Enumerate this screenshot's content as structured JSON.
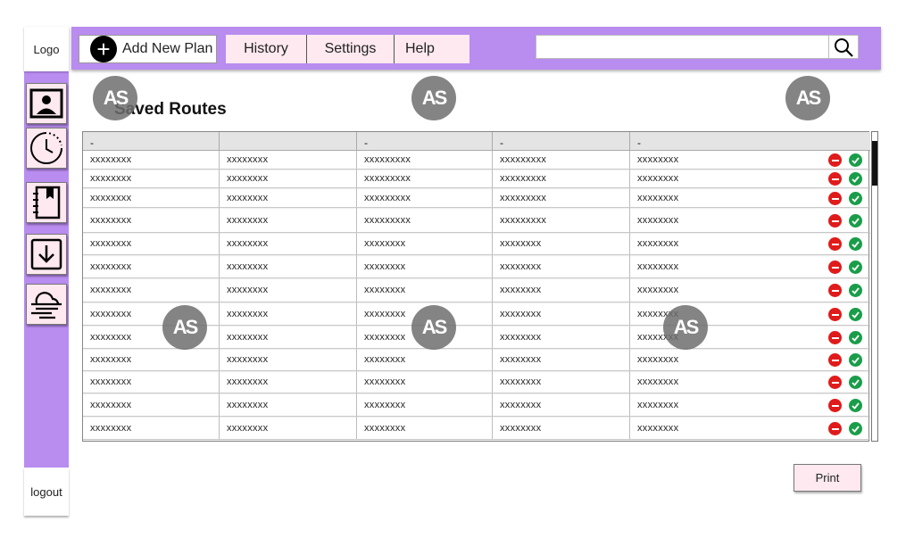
{
  "sidebar": {
    "logo_label": "Logo",
    "logout_label": "logout",
    "items": [
      {
        "icon": "contact-card-icon"
      },
      {
        "icon": "clock-history-icon"
      },
      {
        "icon": "bookmark-notebook-icon"
      },
      {
        "icon": "download-icon"
      },
      {
        "icon": "weather-cloud-wind-icon"
      }
    ]
  },
  "topbar": {
    "add_label": "Add New Plan",
    "nav": {
      "history": "History",
      "settings": "Settings",
      "help": "Help"
    },
    "search": {
      "value": "",
      "placeholder": ""
    }
  },
  "page": {
    "title": "Saved Routes"
  },
  "table": {
    "headers": [
      "-",
      "",
      "-",
      "-",
      "-"
    ],
    "rows": [
      [
        "xxxxxxxx",
        "xxxxxxxx",
        "xxxxxxxxx",
        "xxxxxxxxx",
        "xxxxxxxx"
      ],
      [
        "xxxxxxxx",
        "xxxxxxxx",
        "xxxxxxxxx",
        "xxxxxxxxx",
        "xxxxxxxx"
      ],
      [
        "xxxxxxxx",
        "xxxxxxxx",
        "xxxxxxxxx",
        "xxxxxxxxx",
        "xxxxxxxx"
      ],
      [
        "xxxxxxxx",
        "xxxxxxxx",
        "xxxxxxxxx",
        "xxxxxxxxx",
        "xxxxxxxx"
      ],
      [
        "xxxxxxxx",
        "xxxxxxxx",
        "xxxxxxxx",
        "xxxxxxxx",
        "xxxxxxxx"
      ],
      [
        "xxxxxxxx",
        "xxxxxxxx",
        "xxxxxxxx",
        "xxxxxxxx",
        "xxxxxxxx"
      ],
      [
        "xxxxxxxx",
        "xxxxxxxx",
        "xxxxxxxx",
        "xxxxxxxx",
        "xxxxxxxx"
      ],
      [
        "xxxxxxxx",
        "xxxxxxxx",
        "xxxxxxxx",
        "xxxxxxxx",
        "xxxxxxxx"
      ],
      [
        "xxxxxxxx",
        "xxxxxxxx",
        "xxxxxxxx",
        "xxxxxxxx",
        "xxxxxxxx"
      ],
      [
        "xxxxxxxx",
        "xxxxxxxx",
        "xxxxxxxx",
        "xxxxxxxx",
        "xxxxxxxx"
      ],
      [
        "xxxxxxxx",
        "xxxxxxxx",
        "xxxxxxxx",
        "xxxxxxxx",
        "xxxxxxxx"
      ],
      [
        "xxxxxxxx",
        "xxxxxxxx",
        "xxxxxxxx",
        "xxxxxxxx",
        "xxxxxxxx"
      ],
      [
        "xxxxxxxx",
        "xxxxxxxx",
        "xxxxxxxx",
        "xxxxxxxx",
        "xxxxxxxx"
      ]
    ],
    "actions": {
      "delete_icon": "minus-circle-icon",
      "confirm_icon": "check-circle-icon",
      "delete_color": "#e01b1b",
      "confirm_color": "#1a9d49"
    }
  },
  "footer": {
    "print_label": "Print"
  },
  "watermark": {
    "text": "AS"
  },
  "colors": {
    "accent": "#b98cf0",
    "button_bg": "#fde9ef"
  }
}
